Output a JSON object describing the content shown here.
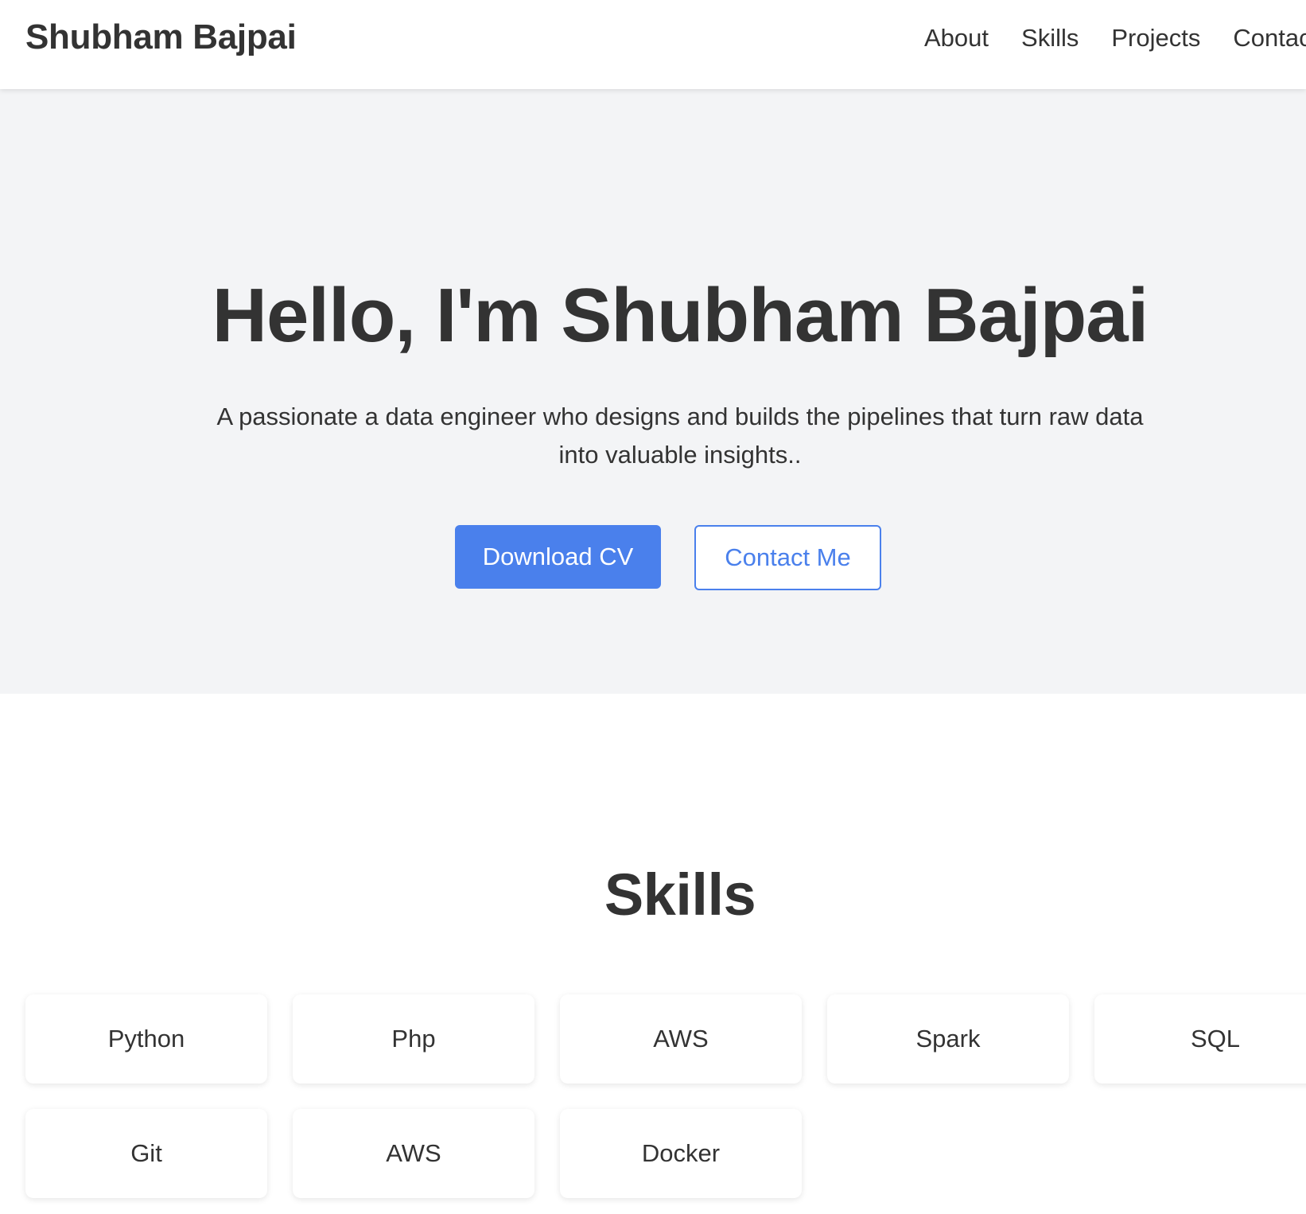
{
  "header": {
    "brand": "Shubham Bajpai",
    "nav": [
      "About",
      "Skills",
      "Projects",
      "Contact"
    ]
  },
  "hero": {
    "title": "Hello, I'm Shubham Bajpai",
    "subtitle": "A passionate a data engineer who designs and builds the pipelines that turn raw data into valuable insights..",
    "primary_button": "Download CV",
    "secondary_button": "Contact Me"
  },
  "skills": {
    "title": "Skills",
    "items": [
      "Python",
      "Php",
      "AWS",
      "Spark",
      "SQL",
      "Git",
      "AWS",
      "Docker"
    ]
  },
  "colors": {
    "accent": "#4a80ec",
    "hero_background": "#f3f4f6",
    "text": "#333333"
  }
}
